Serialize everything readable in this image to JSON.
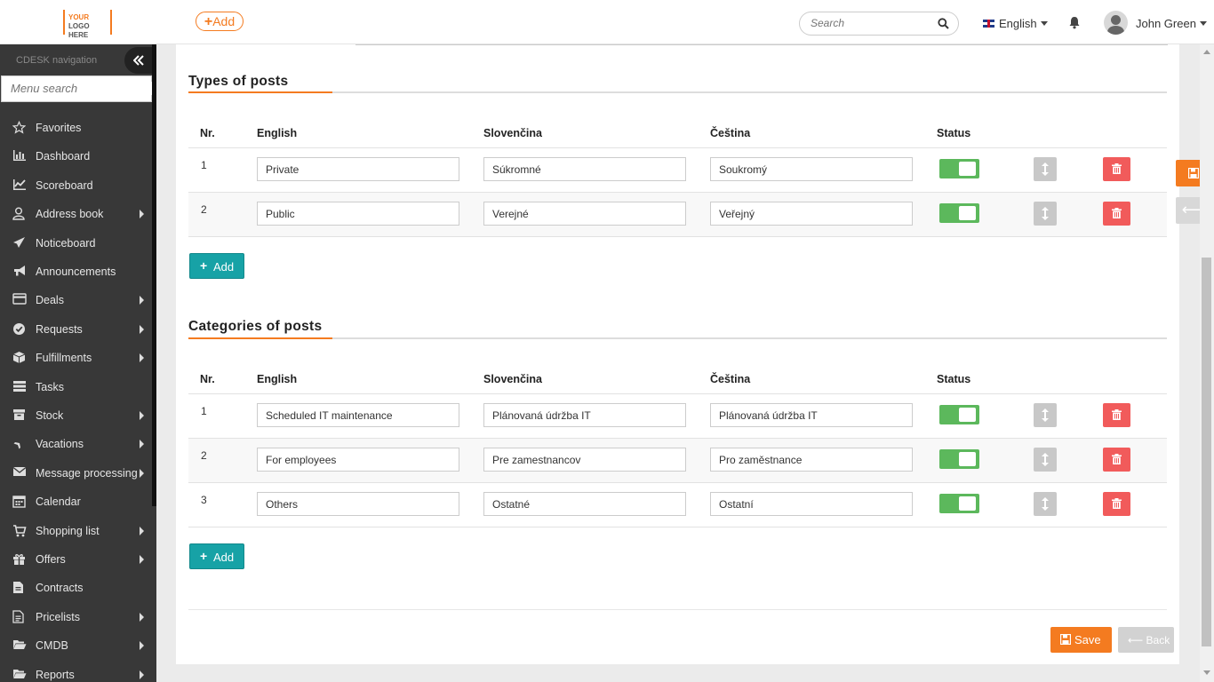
{
  "header": {
    "logo_line1": "YOUR",
    "logo_line1b": "LOGO",
    "logo_line2": "HERE",
    "add_label": "Add",
    "search_placeholder": "Search",
    "language": "English",
    "user_name": "John Green"
  },
  "sidebar": {
    "title": "CDESK navigation",
    "search_placeholder": "Menu search",
    "items": [
      {
        "label": "Favorites",
        "icon": "star-icon",
        "submenu": false
      },
      {
        "label": "Dashboard",
        "icon": "bar-chart-icon",
        "submenu": false
      },
      {
        "label": "Scoreboard",
        "icon": "line-chart-icon",
        "submenu": false
      },
      {
        "label": "Address book",
        "icon": "user-icon",
        "submenu": true
      },
      {
        "label": "Noticeboard",
        "icon": "paper-plane-icon",
        "submenu": false
      },
      {
        "label": "Announcements",
        "icon": "bullhorn-icon",
        "submenu": false
      },
      {
        "label": "Deals",
        "icon": "credit-card-icon",
        "submenu": true
      },
      {
        "label": "Requests",
        "icon": "check-circle-icon",
        "submenu": true
      },
      {
        "label": "Fulfillments",
        "icon": "cube-icon",
        "submenu": true
      },
      {
        "label": "Tasks",
        "icon": "tasks-icon",
        "submenu": false
      },
      {
        "label": "Stock",
        "icon": "archive-icon",
        "submenu": true
      },
      {
        "label": "Vacations",
        "icon": "plane-icon",
        "submenu": true
      },
      {
        "label": "Message processing",
        "icon": "envelope-icon",
        "submenu": true
      },
      {
        "label": "Calendar",
        "icon": "calendar-icon",
        "submenu": false
      },
      {
        "label": "Shopping list",
        "icon": "cart-icon",
        "submenu": true
      },
      {
        "label": "Offers",
        "icon": "gift-icon",
        "submenu": true
      },
      {
        "label": "Contracts",
        "icon": "file-icon",
        "submenu": false
      },
      {
        "label": "Pricelists",
        "icon": "file-text-icon",
        "submenu": true
      },
      {
        "label": "CMDB",
        "icon": "folder-open-icon",
        "submenu": true
      },
      {
        "label": "Reports",
        "icon": "folder-open-icon",
        "submenu": true
      }
    ]
  },
  "columns": {
    "nr": "Nr.",
    "english": "English",
    "slovak": "Slovenčina",
    "czech": "Čeština",
    "status": "Status"
  },
  "types": {
    "title": "Types of posts",
    "rows": [
      {
        "nr": "1",
        "english": "Private",
        "slovak": "Súkromné",
        "czech": "Soukromý",
        "status": true
      },
      {
        "nr": "2",
        "english": "Public",
        "slovak": "Verejné",
        "czech": "Veřejný",
        "status": true
      }
    ],
    "add_label": "Add"
  },
  "categories": {
    "title": "Categories of posts",
    "rows": [
      {
        "nr": "1",
        "english": "Scheduled IT maintenance",
        "slovak": "Plánovaná údržba IT",
        "czech": "Plánovaná údržba IT",
        "status": true
      },
      {
        "nr": "2",
        "english": "For employees",
        "slovak": "Pre zamestnancov",
        "czech": "Pro zaměstnance",
        "status": true
      },
      {
        "nr": "3",
        "english": "Others",
        "slovak": "Ostatné",
        "czech": "Ostatní",
        "status": true
      }
    ],
    "add_label": "Add"
  },
  "footer": {
    "save_label": "Save",
    "back_label": "Back"
  },
  "colors": {
    "accent": "#f47b20",
    "teal": "#17a2a6",
    "toggle_on": "#5cb85c",
    "delete": "#f15b5b"
  }
}
